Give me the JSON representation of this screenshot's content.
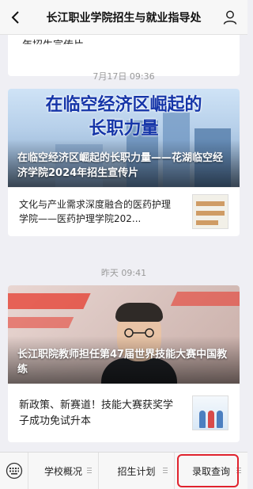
{
  "header": {
    "title": "长江职业学院招生与就业指导处"
  },
  "feed": {
    "top_snippet": "年招生宣传片",
    "group1": {
      "timestamp": "7月17日 09:36",
      "image_headline_line1": "在临空经济区崛起的",
      "image_headline_line2": "长职力量",
      "image_caption": "在临空经济区崛起的长职力量——花湖临空经济学院2024年招生宣传片",
      "row_text": "文化与产业需求深度融合的医药护理学院——医药护理学院202..."
    },
    "group2": {
      "timestamp": "昨天 09:41",
      "image_caption": "长江职院教师担任第47届世界技能大赛中国教练",
      "row_text": "新政策、新赛道！技能大赛获奖学子成功免试升本"
    }
  },
  "menu": {
    "items": [
      {
        "label": "学校概况"
      },
      {
        "label": "招生计划"
      },
      {
        "label": "录取查询"
      }
    ],
    "highlight_color": "#e0232e"
  },
  "icons": [
    "back-icon",
    "user-icon",
    "keyboard-icon",
    "menu-lines-icon"
  ]
}
